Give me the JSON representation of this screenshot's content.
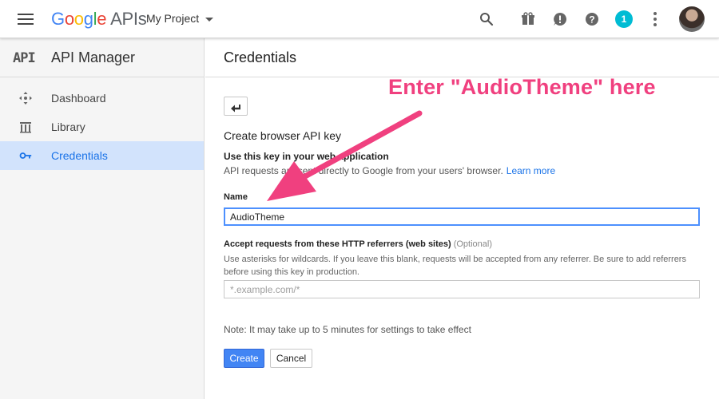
{
  "topbar": {
    "logo_letters": [
      "G",
      "o",
      "o",
      "g",
      "l",
      "e"
    ],
    "logo_suffix": "APIs",
    "project": "My Project",
    "notification_count": "1",
    "icons": [
      "menu-icon",
      "search-icon",
      "gift-icon",
      "alert-icon",
      "help-icon",
      "more-vert-icon"
    ]
  },
  "sidebar": {
    "mark": "API",
    "title": "API Manager",
    "items": [
      {
        "label": "Dashboard",
        "icon": "dashboard-icon",
        "active": false
      },
      {
        "label": "Library",
        "icon": "library-icon",
        "active": false
      },
      {
        "label": "Credentials",
        "icon": "key-icon",
        "active": true
      }
    ]
  },
  "main": {
    "title": "Credentials",
    "heading": "Create browser API key",
    "use_key_title": "Use this key in your web application",
    "api_requests_text": "API requests are sent directly to Google from your users' browser.",
    "learn_more": "Learn more",
    "name_label": "Name",
    "name_value": "AudioTheme",
    "referrers_label": "Accept requests from these HTTP referrers (web sites)",
    "referrers_optional": "(Optional)",
    "referrers_help": "Use asterisks for wildcards. If you leave this blank, requests will be accepted from any referrer. Be sure to add referrers before using this key in production.",
    "referrers_placeholder": "*.example.com/*",
    "note": "Note: It may take up to 5 minutes for settings to take effect",
    "create_label": "Create",
    "cancel_label": "Cancel"
  },
  "annotation": {
    "text": "Enter \"AudioTheme\" here",
    "color": "#f0407f"
  },
  "colors": {
    "accent": "#4285f4",
    "active_nav_bg": "#d2e3fc",
    "badge": "#00bcd4"
  }
}
